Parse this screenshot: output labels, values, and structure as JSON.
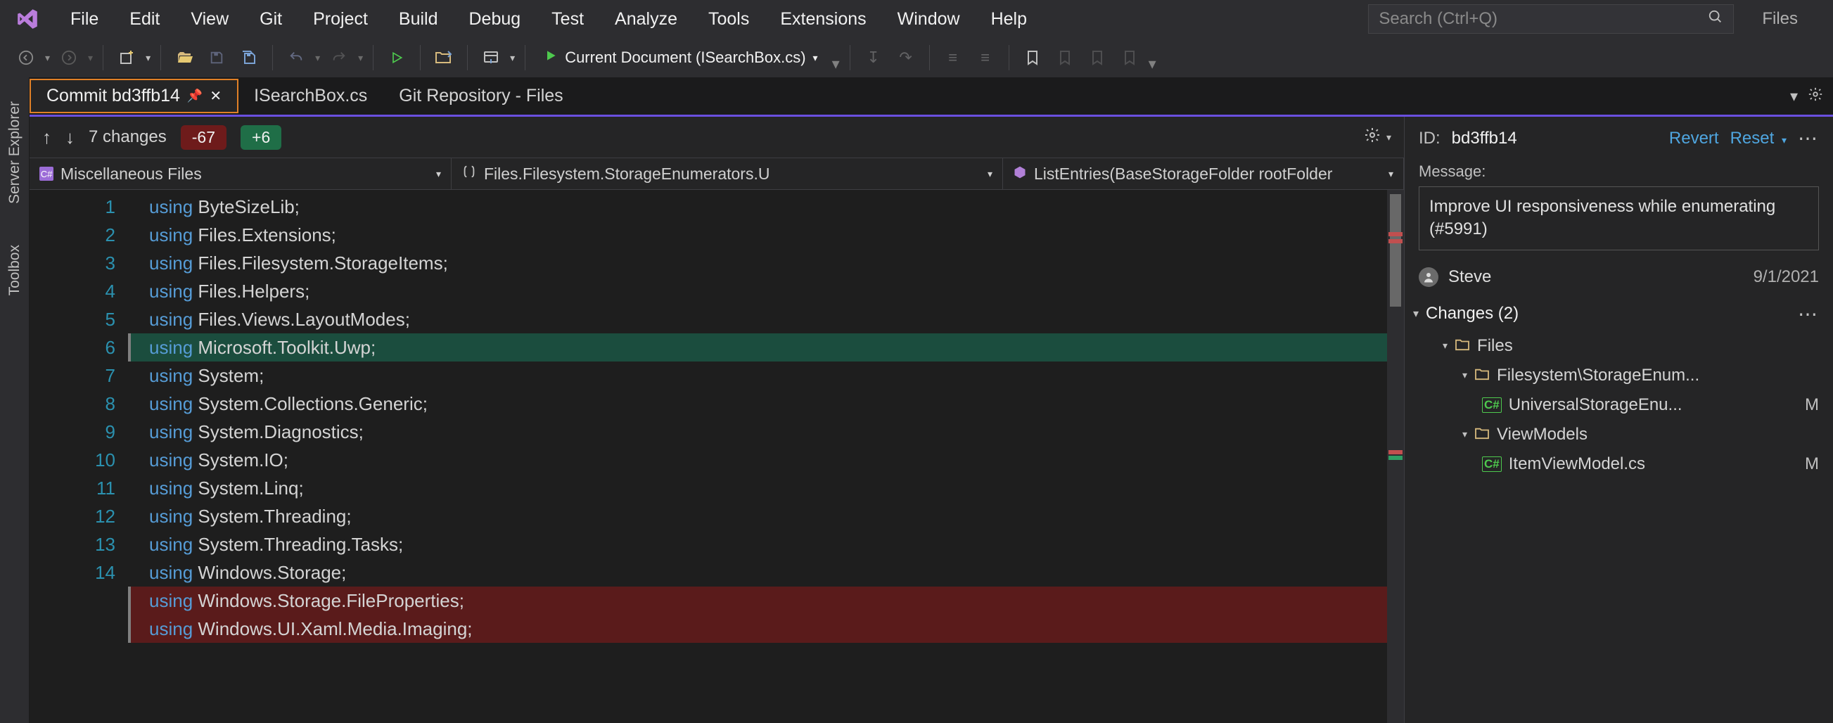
{
  "menu": [
    "File",
    "Edit",
    "View",
    "Git",
    "Project",
    "Build",
    "Debug",
    "Test",
    "Analyze",
    "Tools",
    "Extensions",
    "Window",
    "Help"
  ],
  "search_placeholder": "Search (Ctrl+Q)",
  "title_right": "Files",
  "toolbar": {
    "current_doc": "Current Document (ISearchBox.cs)"
  },
  "tabs": [
    {
      "label": "Commit bd3ffb14",
      "active": true,
      "pinned": true,
      "closable": true
    },
    {
      "label": "ISearchBox.cs",
      "active": false
    },
    {
      "label": "Git Repository - Files",
      "active": false
    }
  ],
  "summary": {
    "changes_text": "7 changes",
    "removed": "-67",
    "added": "+6"
  },
  "crumbs": {
    "c1": "Miscellaneous Files",
    "c2": "Files.Filesystem.StorageEnumerators.U",
    "c3": "ListEntries(BaseStorageFolder rootFolder"
  },
  "code_lines": [
    {
      "n": 1,
      "kw": "using",
      "rest": " ByteSizeLib;",
      "cls": ""
    },
    {
      "n": 2,
      "kw": "using",
      "rest": " Files.Extensions;",
      "cls": ""
    },
    {
      "n": 3,
      "kw": "using",
      "rest": " Files.Filesystem.StorageItems;",
      "cls": ""
    },
    {
      "n": 4,
      "kw": "using",
      "rest": " Files.Helpers;",
      "cls": ""
    },
    {
      "n": 5,
      "kw": "using",
      "rest": " Files.Views.LayoutModes;",
      "cls": ""
    },
    {
      "n": 6,
      "kw": "using",
      "rest": " Microsoft.Toolkit.Uwp;",
      "cls": "added",
      "bracket": true
    },
    {
      "n": 7,
      "kw": "using",
      "rest": " System;",
      "cls": ""
    },
    {
      "n": 8,
      "kw": "using",
      "rest": " System.Collections.Generic;",
      "cls": ""
    },
    {
      "n": 9,
      "kw": "using",
      "rest": " System.Diagnostics;",
      "cls": ""
    },
    {
      "n": 10,
      "kw": "using",
      "rest": " System.IO;",
      "cls": ""
    },
    {
      "n": 11,
      "kw": "using",
      "rest": " System.Linq;",
      "cls": ""
    },
    {
      "n": 12,
      "kw": "using",
      "rest": " System.Threading;",
      "cls": ""
    },
    {
      "n": 13,
      "kw": "using",
      "rest": " System.Threading.Tasks;",
      "cls": ""
    },
    {
      "n": 14,
      "kw": "using",
      "rest": " Windows.Storage;",
      "cls": ""
    },
    {
      "n": "",
      "kw": "using",
      "rest": " Windows.Storage.FileProperties;",
      "cls": "removed",
      "bracket": true
    },
    {
      "n": "",
      "kw": "using",
      "rest": " Windows.UI.Xaml.Media.Imaging;",
      "cls": "removed",
      "bracket": true
    }
  ],
  "commit": {
    "id_label": "ID:",
    "id": "bd3ffb14",
    "revert": "Revert",
    "reset": "Reset",
    "message_label": "Message:",
    "message": "Improve UI responsiveness while enumerating (#5991)",
    "author": "Steve",
    "date": "9/1/2021",
    "changes_header": "Changes (2)",
    "tree": [
      {
        "lvl": 1,
        "type": "folder",
        "label": "Files"
      },
      {
        "lvl": 2,
        "type": "folder",
        "label": "Filesystem\\StorageEnum..."
      },
      {
        "lvl": 3,
        "type": "csfile",
        "label": "UniversalStorageEnu...",
        "flag": "M"
      },
      {
        "lvl": 2,
        "type": "folder",
        "label": "ViewModels"
      },
      {
        "lvl": 3,
        "type": "csfile",
        "label": "ItemViewModel.cs",
        "flag": "M"
      }
    ]
  },
  "sidebar_tabs": [
    "Server Explorer",
    "Toolbox"
  ]
}
